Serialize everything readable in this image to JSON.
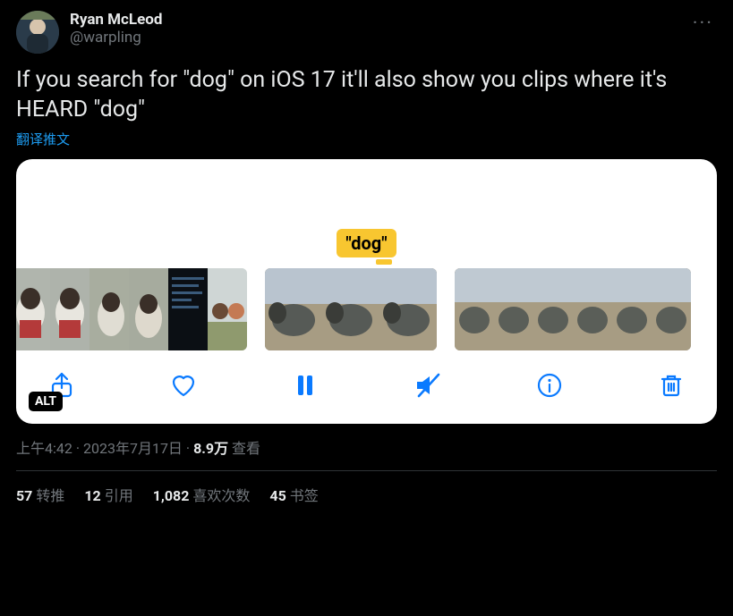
{
  "user": {
    "display_name": "Ryan McLeod",
    "handle": "@warpling"
  },
  "tweet_text": "If you search for \"dog\" on iOS 17 it'll also show you clips where it's HEARD \"dog\"",
  "translate_label": "翻译推文",
  "media": {
    "search_chip": "\"dog\"",
    "alt_badge": "ALT"
  },
  "meta": {
    "time": "上午4:42",
    "sep1": " · ",
    "date": "2023年7月17日",
    "sep2": " · ",
    "views_count": "8.9万",
    "views_label": " 查看"
  },
  "stats": {
    "retweets_count": "57",
    "retweets_label": "转推",
    "quotes_count": "12",
    "quotes_label": "引用",
    "likes_count": "1,082",
    "likes_label": "喜欢次数",
    "bookmarks_count": "45",
    "bookmarks_label": "书签"
  },
  "more_label": "···"
}
